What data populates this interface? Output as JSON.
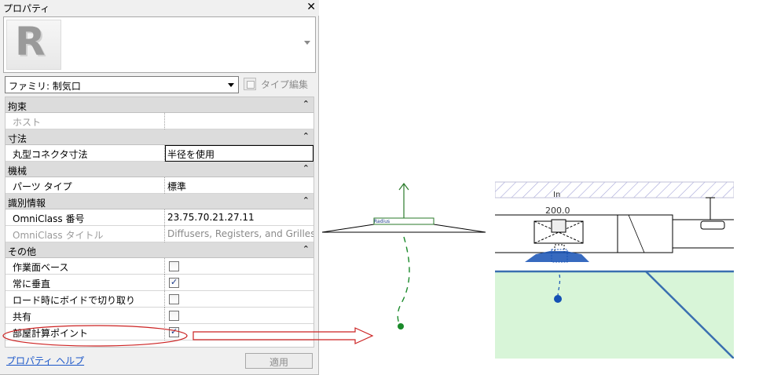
{
  "palette": {
    "title": "プロパティ",
    "family_selector": "ファミリ: 制気口",
    "edit_type_label": "タイプ編集",
    "groups": [
      {
        "name": "拘束",
        "rows": [
          {
            "key": "ホスト",
            "value": "",
            "dim": true
          }
        ]
      },
      {
        "name": "寸法",
        "rows": [
          {
            "key": "丸型コネクタ寸法",
            "value": "半径を使用"
          }
        ]
      },
      {
        "name": "機械",
        "rows": [
          {
            "key": "パーツ タイプ",
            "value": "標準"
          }
        ]
      },
      {
        "name": "識別情報",
        "rows": [
          {
            "key": "OmniClass 番号",
            "value": "23.75.70.21.27.11"
          },
          {
            "key": "OmniClass タイトル",
            "value": "Diffusers, Registers, and Grilles",
            "dim": true
          }
        ]
      },
      {
        "name": "その他",
        "rows": [
          {
            "key": "作業面ベース",
            "checked": false
          },
          {
            "key": "常に垂直",
            "checked": true
          },
          {
            "key": "ロード時にボイドで切り取り",
            "checked": false
          },
          {
            "key": "共有",
            "checked": false
          },
          {
            "key": "部屋計算ポイント",
            "checked": true
          }
        ]
      }
    ],
    "help_link": "プロパティ ヘルプ",
    "apply_button": "適用",
    "collapse_icon": "double-chevron-up-icon"
  },
  "family_view": {
    "connector_label": "Radius"
  },
  "model_view": {
    "dimension_label": "200.0",
    "level_label": "In"
  },
  "colors": {
    "highlight_circle": "#cc2222",
    "arrow": "#cc2222",
    "point_green": "#1a8a2a",
    "point_blue": "#1450b4",
    "room_fill": "#d8f5d8",
    "room_line": "#3a6fb0"
  }
}
